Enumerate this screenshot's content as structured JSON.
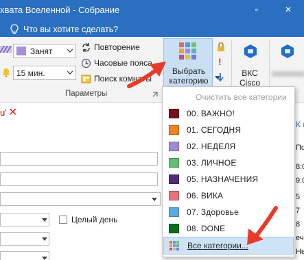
{
  "window": {
    "title": "хвата Вселенной - Собрание",
    "restore_symbol": "▫",
    "close_symbol": "✕"
  },
  "tellme": {
    "text": "Что вы хотите сделать?"
  },
  "ribbon": {
    "show_as_value": "Занят",
    "reminder_value": "15 мин.",
    "recurrence_label": "Повторение",
    "timezones_label": "Часовые пояса",
    "room_finder_label": "Поиск комнаты",
    "categorize_label_1": "Выбрать",
    "categorize_label_2": "категорию",
    "skype_label_1": "ВКС",
    "skype_label_2": "Cisco",
    "options_group_label": "Параметры",
    "colors": {
      "busy": "#a68fd6",
      "accent": "#2b6fc1"
    }
  },
  "form": {
    "allday_label": "Целый день",
    "fragment_text": "u'",
    "right_fragments": [
      "К п",
      "Пол",
      "8:0",
      "9:0",
      "5",
      "7",
      "8",
      "ечер",
      "Нет"
    ]
  },
  "categories_menu": {
    "clear_label": "Очистить все категории",
    "items": [
      {
        "label": "00. ВАЖНО!",
        "color": "#7a0f1c"
      },
      {
        "label": "01. СЕГОДНЯ",
        "color": "#f58220"
      },
      {
        "label": "02. НЕДЕЛЯ",
        "color": "#a08bd8"
      },
      {
        "label": "03. ЛИЧНОЕ",
        "color": "#5fbf73"
      },
      {
        "label": "05. НАЗНАЧЕНИЯ",
        "color": "#4e2c7a"
      },
      {
        "label": "06. ВИКА",
        "color": "#e8727a"
      },
      {
        "label": "07. Здоровье",
        "color": "#5ba8e2"
      },
      {
        "label": "08. DONE",
        "color": "#0c6e1c"
      }
    ],
    "all_categories_label": "Все категории..."
  }
}
